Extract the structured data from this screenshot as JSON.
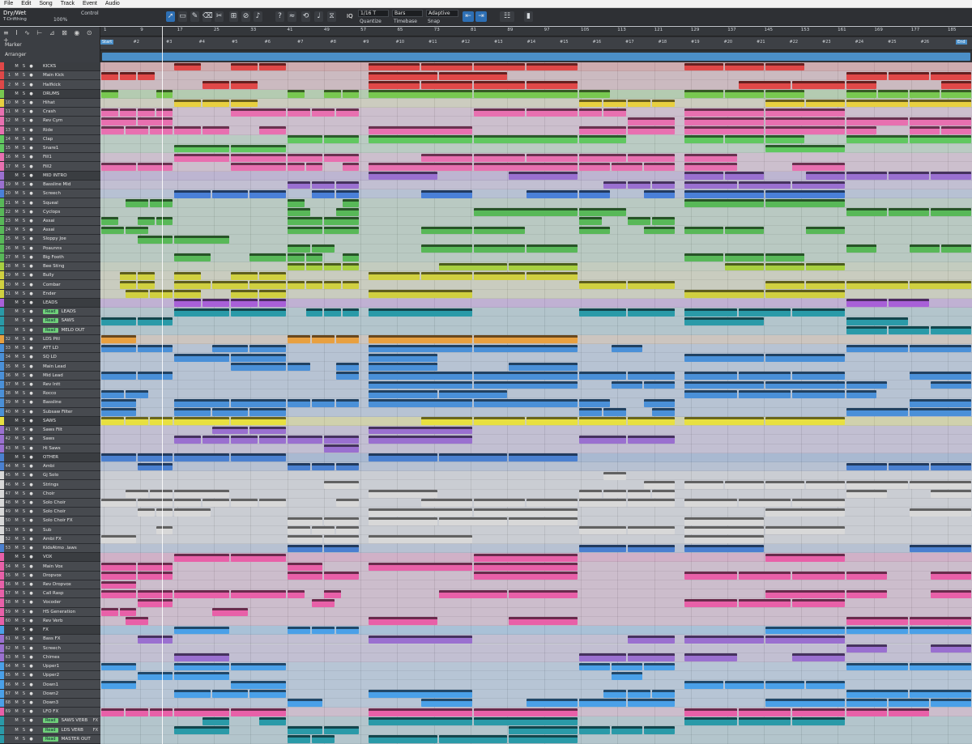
{
  "menu": [
    "File",
    "Edit",
    "Song",
    "Track",
    "Event",
    "Audio"
  ],
  "toolbar": {
    "instrument": "Dry/Wet",
    "song_name": "T-Drifthing",
    "zoom": "100%",
    "control_label": "Control",
    "quantize_value": "1/16 T",
    "quantize_label": "Quantize",
    "timebase_value": "Bars",
    "timebase_label": "Timebase",
    "snap_value": "Adaptive",
    "snap_label": "Snap",
    "iq_label": "IQ"
  },
  "header": {
    "marker_label": "Marker",
    "arranger_label": "Arranger"
  },
  "ruler": [
    "1",
    "9",
    "17",
    "25",
    "33",
    "41",
    "49",
    "57",
    "65",
    "73",
    "81",
    "89",
    "97",
    "105",
    "113",
    "121",
    "129",
    "137",
    "145",
    "153",
    "161",
    "169",
    "177",
    "185"
  ],
  "markers": [
    "Start",
    "#2",
    "#3",
    "#4",
    "#5",
    "#6",
    "#7",
    "#8",
    "#9",
    "#10",
    "#11",
    "#12",
    "#13",
    "#14",
    "#15",
    "#16",
    "#17",
    "#18",
    "#19",
    "#20",
    "#21",
    "#22",
    "#23",
    "#24",
    "#25",
    "#26",
    "End"
  ],
  "tracks": [
    {
      "num": "",
      "name": "KICKS",
      "color": "#e04848",
      "folder": true
    },
    {
      "num": "1",
      "name": "Main Kick",
      "color": "#e04848"
    },
    {
      "num": "2",
      "name": "Halfkick",
      "color": "#e04848"
    },
    {
      "num": "",
      "name": "DRUMS",
      "color": "#78c850",
      "folder": true
    },
    {
      "num": "10",
      "name": "Hihat",
      "color": "#e8d040"
    },
    {
      "num": "11",
      "name": "Crash",
      "color": "#e870b0"
    },
    {
      "num": "12",
      "name": "Rev Cym",
      "color": "#e870b0"
    },
    {
      "num": "13",
      "name": "Ride",
      "color": "#e870b0"
    },
    {
      "num": "14",
      "name": "Clap",
      "color": "#60c860"
    },
    {
      "num": "15",
      "name": "Snare1",
      "color": "#60c860"
    },
    {
      "num": "16",
      "name": "Fill1",
      "color": "#e870b0"
    },
    {
      "num": "17",
      "name": "Fill2",
      "color": "#e870b0"
    },
    {
      "num": "",
      "name": "MID INTRO",
      "color": "#9a70d0",
      "folder": true
    },
    {
      "num": "19",
      "name": "Bassline Mid",
      "color": "#9a70d0"
    },
    {
      "num": "20",
      "name": "Screech",
      "color": "#4a80d8"
    },
    {
      "num": "21",
      "name": "Squeal",
      "color": "#58b858"
    },
    {
      "num": "22",
      "name": "Cyclops",
      "color": "#58b858"
    },
    {
      "num": "23",
      "name": "Assai",
      "color": "#58b858"
    },
    {
      "num": "24",
      "name": "Assai",
      "color": "#58b858"
    },
    {
      "num": "25",
      "name": "Sloppy Joe",
      "color": "#58b858"
    },
    {
      "num": "26",
      "name": "Poaunns",
      "color": "#58b858"
    },
    {
      "num": "27",
      "name": "Big Footh",
      "color": "#58b858"
    },
    {
      "num": "28",
      "name": "Bee Sting",
      "color": "#a8d040"
    },
    {
      "num": "29",
      "name": "Bully",
      "color": "#d0d040"
    },
    {
      "num": "30",
      "name": "Combar",
      "color": "#d0d040"
    },
    {
      "num": "31",
      "name": "Ender",
      "color": "#d0d040"
    },
    {
      "num": "",
      "name": "LEADS",
      "color": "#a860d8",
      "folder": true
    },
    {
      "num": "",
      "name": "LEADS",
      "color": "#2a9aa8",
      "read": true
    },
    {
      "num": "",
      "name": "SAWS",
      "color": "#2a9aa8",
      "read": true
    },
    {
      "num": "",
      "name": "MELO OUT",
      "color": "#2a9aa8",
      "read": true
    },
    {
      "num": "32",
      "name": "LDS Pitl",
      "color": "#e8a040"
    },
    {
      "num": "33",
      "name": "ATT LD",
      "color": "#4a90d8"
    },
    {
      "num": "34",
      "name": "SQ LD",
      "color": "#4a90d8"
    },
    {
      "num": "35",
      "name": "Main Lead",
      "color": "#4a90d8"
    },
    {
      "num": "36",
      "name": "Mid Lead",
      "color": "#4a90d8"
    },
    {
      "num": "37",
      "name": "Rev Intt",
      "color": "#4a90d8"
    },
    {
      "num": "38",
      "name": "Rocco",
      "color": "#4a90d8"
    },
    {
      "num": "39",
      "name": "Bassline",
      "color": "#4a90d8"
    },
    {
      "num": "40",
      "name": "Subsaw Filter",
      "color": "#4a90d8"
    },
    {
      "num": "",
      "name": "SAWS",
      "color": "#e8e040",
      "folder": true
    },
    {
      "num": "41",
      "name": "Saws Filt",
      "color": "#9a70d0"
    },
    {
      "num": "42",
      "name": "Saws",
      "color": "#9a70d0"
    },
    {
      "num": "43",
      "name": "Hi Saws",
      "color": "#9a70d0"
    },
    {
      "num": "",
      "name": "OTHER",
      "color": "#4a80d0",
      "folder": true
    },
    {
      "num": "44",
      "name": "Ambi",
      "color": "#4a80d0"
    },
    {
      "num": "45",
      "name": "Gj Solo",
      "color": "#d8d8d8"
    },
    {
      "num": "46",
      "name": "Strings",
      "color": "#d8d8d8"
    },
    {
      "num": "47",
      "name": "Choir",
      "color": "#d8d8d8"
    },
    {
      "num": "48",
      "name": "Solo Choir",
      "color": "#d8d8d8"
    },
    {
      "num": "49",
      "name": "Solo Choir",
      "color": "#d8d8d8"
    },
    {
      "num": "50",
      "name": "Solo Choir FX",
      "color": "#d8d8d8"
    },
    {
      "num": "51",
      "name": "Sub",
      "color": "#d8d8d8"
    },
    {
      "num": "52",
      "name": "Ambi FX",
      "color": "#d8d8d8"
    },
    {
      "num": "53",
      "name": "KidsAtmo .laws",
      "color": "#4a80d0"
    },
    {
      "num": "",
      "name": "VOX",
      "color": "#e860a8",
      "folder": true
    },
    {
      "num": "54",
      "name": "Main Vox",
      "color": "#e860a8"
    },
    {
      "num": "55",
      "name": "Dropvox",
      "color": "#e860a8"
    },
    {
      "num": "56",
      "name": "Rev Dropvox",
      "color": "#e860a8"
    },
    {
      "num": "57",
      "name": "Call Rasp",
      "color": "#e860a8"
    },
    {
      "num": "58",
      "name": "Vocoder",
      "color": "#e860a8"
    },
    {
      "num": "59",
      "name": "HS Generation",
      "color": "#e860a8"
    },
    {
      "num": "60",
      "name": "Rev Verb",
      "color": "#e860a8"
    },
    {
      "num": "",
      "name": "FX",
      "color": "#4aa0e8",
      "folder": true
    },
    {
      "num": "61",
      "name": "Bass FX",
      "color": "#9a70d0"
    },
    {
      "num": "62",
      "name": "Screech",
      "color": "#9a70d0"
    },
    {
      "num": "63",
      "name": "Chimes",
      "color": "#9a70d0"
    },
    {
      "num": "64",
      "name": "Upper1",
      "color": "#4aa0e8"
    },
    {
      "num": "65",
      "name": "Upper2",
      "color": "#4aa0e8"
    },
    {
      "num": "66",
      "name": "Down1",
      "color": "#4aa0e8"
    },
    {
      "num": "67",
      "name": "Down2",
      "color": "#4aa0e8"
    },
    {
      "num": "68",
      "name": "Down3",
      "color": "#4aa0e8"
    },
    {
      "num": "69",
      "name": "LFO FX",
      "color": "#e860a8"
    },
    {
      "num": "",
      "name": "SAWS VERB",
      "color": "#2a9aa8",
      "read": true,
      "fx": true
    },
    {
      "num": "",
      "name": "LDS VERB",
      "color": "#2a9aa8",
      "read": true,
      "fx": true
    },
    {
      "num": "",
      "name": "MASTER OUT",
      "color": "#2a9aa8",
      "read": true
    }
  ],
  "read_label": "Read",
  "fx_label": "FX",
  "lane_colors": {
    "kicks": "#e04848",
    "drums": "#60c860",
    "pink": "#e870b0",
    "purple": "#a878e0",
    "green": "#58b858",
    "blue": "#4a90d8",
    "orange": "#e8a040",
    "yellow": "#e8e040",
    "gray": "#d8d8d8",
    "vox": "#e860a8",
    "fx": "#4aa0e8"
  }
}
